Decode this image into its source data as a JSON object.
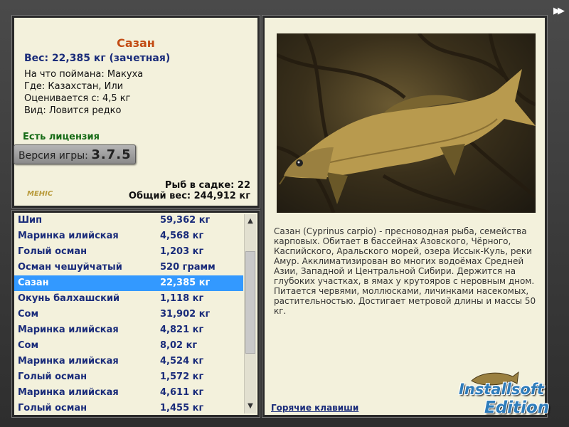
{
  "fish": {
    "name": "Сазан",
    "weight_line": "Вес: 22,385 кг (зачетная)",
    "bait": "На что поймана: Макуха",
    "location": "Где: Казахстан, Или",
    "valued_from": "Оценивается с: 4,5 кг",
    "rarity": "Вид: Ловится редко"
  },
  "license": "Есть лицензия",
  "version": {
    "label": "Версия игры:",
    "value": "3.7.5"
  },
  "logo_text": "MEHIC",
  "stats": {
    "fish_count": "Рыб в садке: 22",
    "total_weight": "Общий вес: 244,912 кг"
  },
  "catch_list": [
    {
      "name": "Шип",
      "weight": "59,362 кг"
    },
    {
      "name": "Маринка илийская",
      "weight": "4,568 кг"
    },
    {
      "name": "Голый осман",
      "weight": "1,203 кг"
    },
    {
      "name": "Осман чешуйчатый",
      "weight": "520 грамм"
    },
    {
      "name": "Сазан",
      "weight": "22,385 кг",
      "selected": true
    },
    {
      "name": "Окунь балхашский",
      "weight": "1,118 кг"
    },
    {
      "name": "Сом",
      "weight": "31,902 кг"
    },
    {
      "name": "Маринка илийская",
      "weight": "4,821 кг"
    },
    {
      "name": "Сом",
      "weight": "8,02 кг"
    },
    {
      "name": "Маринка илийская",
      "weight": "4,524 кг"
    },
    {
      "name": "Голый осман",
      "weight": "1,572 кг"
    },
    {
      "name": "Маринка илийская",
      "weight": "4,611 кг"
    },
    {
      "name": "Голый осман",
      "weight": "1,455 кг"
    }
  ],
  "description": "Сазан (Cyprinus carpio) - пресноводная рыба, семейства карповых. Обитает в бассейнах Азовского, Чёрного, Каспийского, Аральского морей, озера Иссык-Куль, реки Амур. Акклиматизирован во многих водоёмах Средней Азии, Западной и Центральной Сибири. Держится на глубоких участках, в ямах у крутояров с неровным дном. Питается червями, моллюсками, личинками насекомых, растительностью. Достигает метровой длины и массы 50 кг.",
  "hotkeys_link": "Горячие клавиши",
  "ff_icon": "fast-forward-icon",
  "watermark": {
    "line1": "Installsoft",
    "line2": "Edition"
  },
  "colors": {
    "selected_row": "#3399ff",
    "fish_title": "#c24a12",
    "list_text": "#1a2c7a",
    "panel_bg": "#f3f1dc"
  }
}
